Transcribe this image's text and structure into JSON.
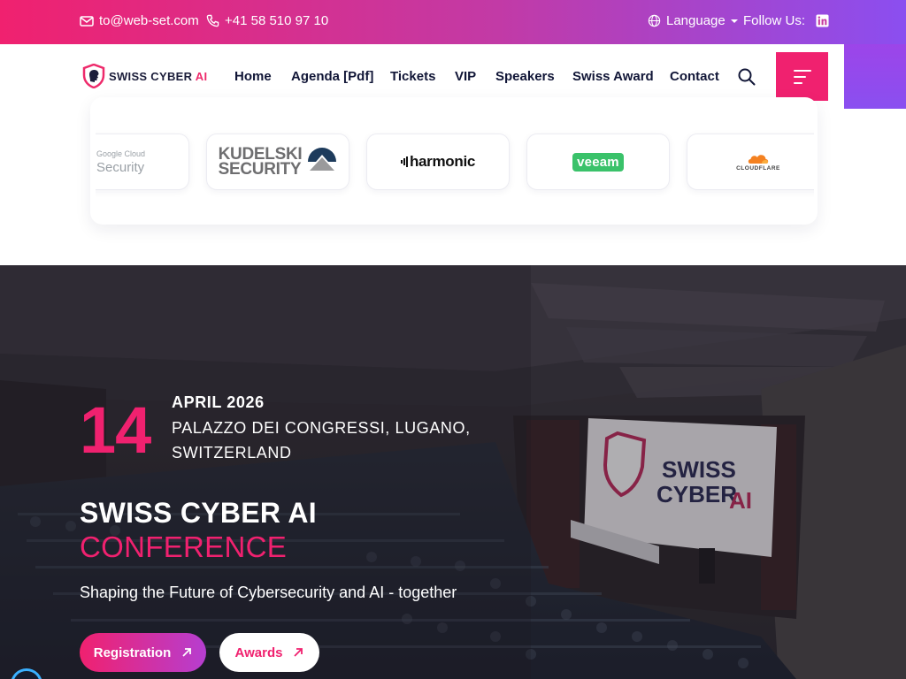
{
  "topbar": {
    "email": "to@web-set.com",
    "phone": "+41 58 510 97 10",
    "language_label": "Language",
    "follow_label": "Follow Us:",
    "social_icon": "linkedin-icon"
  },
  "brand": {
    "logo_text_main": "SWISS CYBER",
    "logo_text_ai": "AI"
  },
  "nav": {
    "items": [
      "Home",
      "Agenda [Pdf]",
      "Tickets",
      "VIP",
      "Speakers",
      "Swiss Award",
      "Contact"
    ]
  },
  "sponsors": [
    {
      "name": "Google Cloud Security",
      "line1": "Google Cloud",
      "line2": "Security"
    },
    {
      "name": "Kudelski Security",
      "line1": "KUDELSKI",
      "line2": "SECURITY"
    },
    {
      "name": "harmonic",
      "line1": "harmonic"
    },
    {
      "name": "veeam",
      "line1": "veeam"
    },
    {
      "name": "Cloudflare",
      "line1": "CLOUDFLARE"
    }
  ],
  "hero": {
    "day": "14",
    "month_year": "APRIL 2026",
    "venue_line1": "PALAZZO DEI CONGRESSI, LUGANO,",
    "venue_line2": "SWITZERLAND",
    "title_line1": "SWISS CYBER AI",
    "title_line2": "CONFERENCE",
    "subtitle": "Shaping the Future of Cybersecurity and AI - together",
    "register_label": "Registration",
    "awards_label": "Awards",
    "screen_line1": "SWISS",
    "screen_line2": "CYBER",
    "screen_line3": "AI"
  },
  "colors": {
    "accent": "#f0216f",
    "purple": "#8b4ef0",
    "navy": "#111637"
  }
}
